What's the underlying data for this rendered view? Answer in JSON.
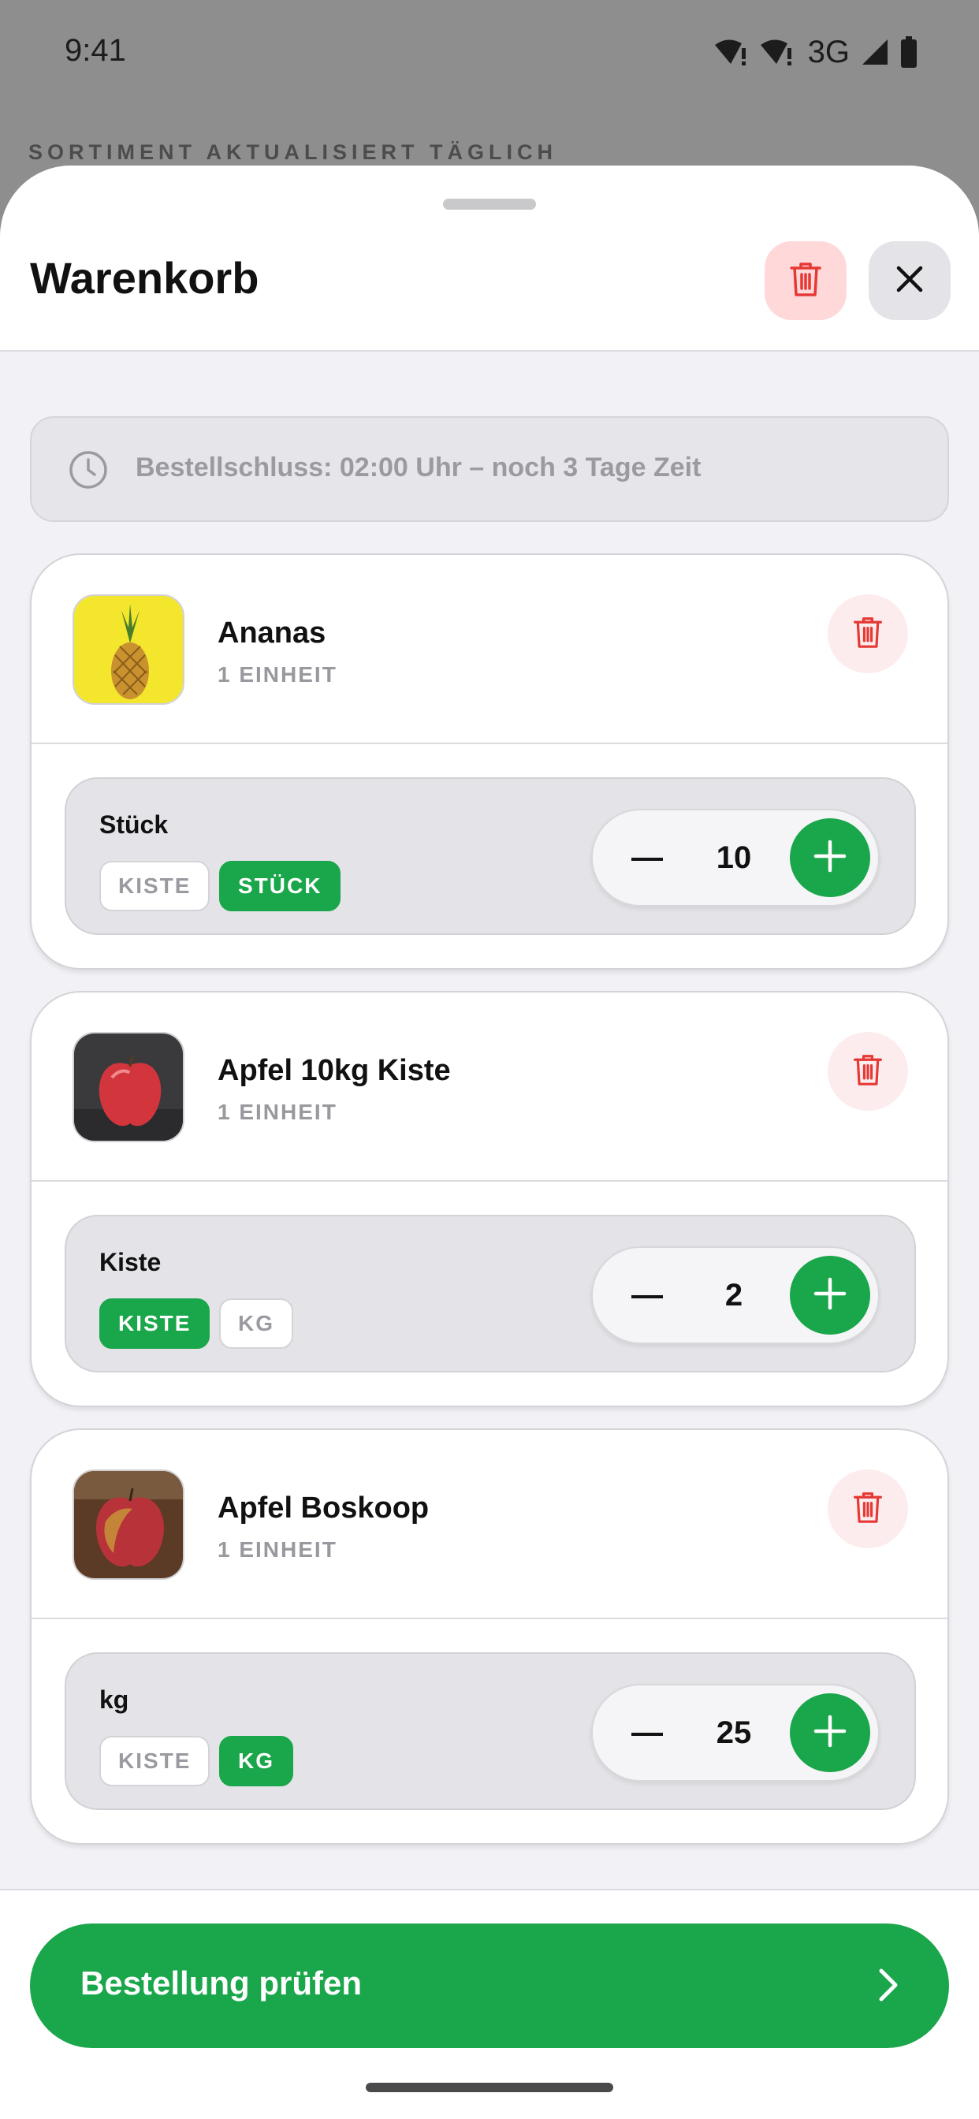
{
  "status_bar": {
    "time": "9:41",
    "network": "3G",
    "icons": [
      "wifi-alert-icon",
      "wifi-alert-icon",
      "signal-icon",
      "battery-icon"
    ]
  },
  "backdrop": {
    "caption": "SORTIMENT AKTUALISIERT TÄGLICH"
  },
  "cart": {
    "title": "Warenkorb",
    "clear_icon": "trash-icon",
    "close_icon": "close-icon",
    "deadline_icon": "clock-icon",
    "deadline": "Bestellschluss: 02:00 Uhr – noch 3 Tage Zeit",
    "items": [
      {
        "name": "Ananas",
        "subtitle": "1 EINHEIT",
        "image": "pineapple-image",
        "unit_label": "Stück",
        "chips": [
          {
            "label": "KISTE",
            "selected": false
          },
          {
            "label": "STÜCK",
            "selected": true
          }
        ],
        "quantity": "10"
      },
      {
        "name": "Apfel 10kg Kiste",
        "subtitle": "1 EINHEIT",
        "image": "red-apple-image",
        "unit_label": "Kiste",
        "chips": [
          {
            "label": "KISTE",
            "selected": true
          },
          {
            "label": "KG",
            "selected": false
          }
        ],
        "quantity": "2"
      },
      {
        "name": "Apfel Boskoop",
        "subtitle": "1 EINHEIT",
        "image": "boskoop-apple-image",
        "unit_label": "kg",
        "chips": [
          {
            "label": "KISTE",
            "selected": false
          },
          {
            "label": "KG",
            "selected": true
          }
        ],
        "quantity": "25"
      }
    ]
  },
  "footer": {
    "cta_label": "Bestellung prüfen",
    "cta_icon": "chevron-right-icon"
  },
  "colors": {
    "accent_green": "#1aa64a",
    "danger_red": "#e53935",
    "danger_bg": "#ffd9da"
  }
}
